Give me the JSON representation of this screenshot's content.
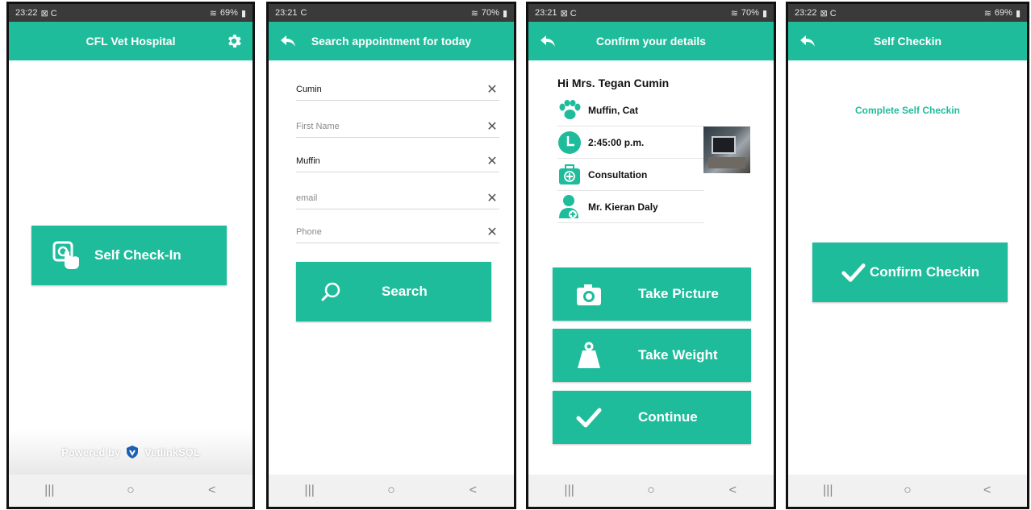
{
  "colors": {
    "accent": "#1fbc9c",
    "statusbar": "#3a3a3a",
    "navbar": "#f1f1f1"
  },
  "screens": [
    {
      "status": {
        "time": "23:22",
        "icons": "⊠ C",
        "battery": "69%"
      },
      "header": {
        "title": "CFL Vet Hospital"
      },
      "self_checkin_label": "Self Check-In",
      "powered_by": "Powered by",
      "brand": "VetlinkSQL"
    },
    {
      "status": {
        "time": "23:21",
        "icons": "C",
        "battery": "70%"
      },
      "header": {
        "title": "Search appointment for today"
      },
      "fields": [
        {
          "value": "Cumin",
          "placeholder": ""
        },
        {
          "value": "",
          "placeholder": "First Name"
        },
        {
          "value": "Muffin",
          "placeholder": ""
        },
        {
          "value": "",
          "placeholder": "email"
        },
        {
          "value": "",
          "placeholder": "Phone"
        }
      ],
      "search_label": "Search"
    },
    {
      "status": {
        "time": "23:21",
        "icons": "⊠ C",
        "battery": "70%"
      },
      "header": {
        "title": "Confirm your details"
      },
      "greeting": "Hi Mrs. Tegan Cumin",
      "details": [
        {
          "text": "Muffin, Cat",
          "icon": "paw-icon"
        },
        {
          "text": "2:45:00 p.m.",
          "icon": "clock-icon"
        },
        {
          "text": "Consultation",
          "icon": "medical-kit-icon"
        },
        {
          "text": "Mr. Kieran Daly",
          "icon": "doctor-icon"
        }
      ],
      "take_picture_label": "Take Picture",
      "take_weight_label": "Take Weight",
      "continue_label": "Continue"
    },
    {
      "status": {
        "time": "23:22",
        "icons": "⊠ C",
        "battery": "69%"
      },
      "header": {
        "title": "Self Checkin"
      },
      "subtitle": "Complete Self Checkin",
      "confirm_label": "Confirm Checkin"
    }
  ],
  "nav": {
    "recent": "|||",
    "home": "○",
    "back": "<"
  }
}
